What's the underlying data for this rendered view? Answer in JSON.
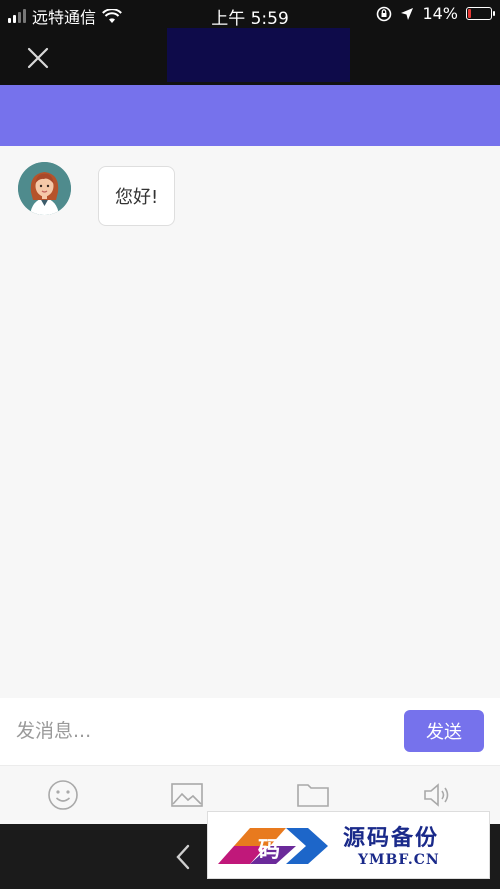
{
  "status_bar": {
    "carrier": "远特通信",
    "time": "上午 5:59",
    "battery_percent": "14%",
    "battery_level": 0.14
  },
  "chat": {
    "messages": [
      {
        "sender": "agent",
        "text": "您好!"
      }
    ]
  },
  "composer": {
    "placeholder": "发消息...",
    "send_label": "发送"
  },
  "toolbar": {
    "items": [
      "emoji-icon",
      "image-icon",
      "folder-icon",
      "speaker-icon"
    ]
  },
  "watermark": {
    "logo_char": "码",
    "title": "源码备份",
    "domain": "YMBF.CN"
  },
  "colors": {
    "accent": "#7672ec",
    "header_dark": "#111111",
    "title_block": "#0e0b4a"
  }
}
